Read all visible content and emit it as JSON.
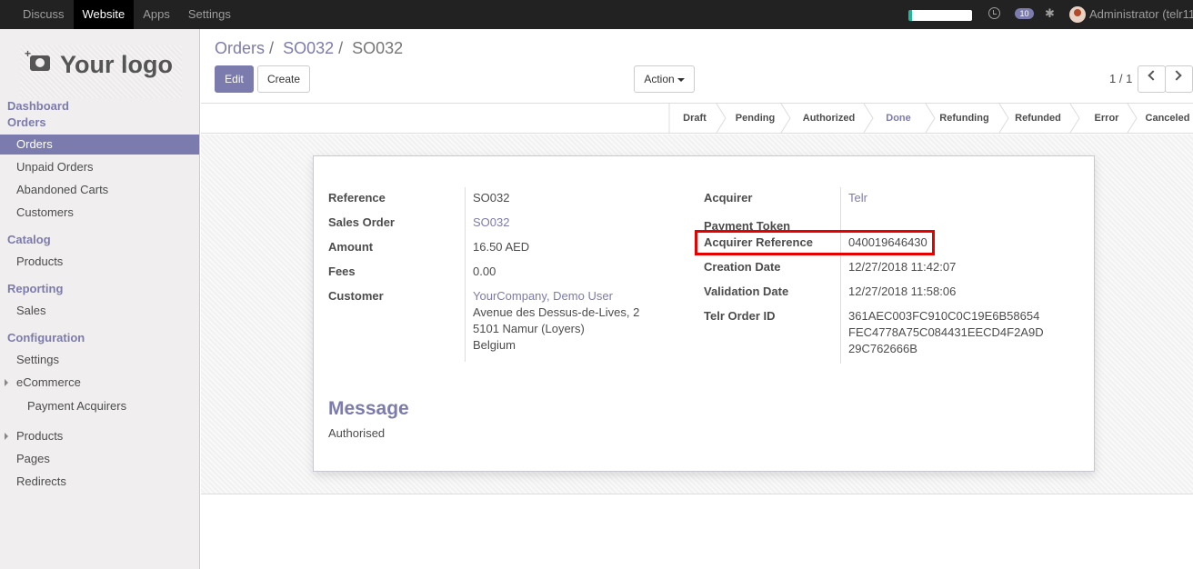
{
  "topbar": {
    "menu": [
      "Discuss",
      "Website",
      "Apps",
      "Settings"
    ],
    "chat_count": "10",
    "user": "Administrator (telr11"
  },
  "sidebar": {
    "logo": "Your logo",
    "dashboard": "Dashboard",
    "orders_section": "Orders",
    "orders_items": [
      "Orders",
      "Unpaid Orders",
      "Abandoned Carts",
      "Customers"
    ],
    "catalog_section": "Catalog",
    "catalog_items": [
      "Products"
    ],
    "reporting_section": "Reporting",
    "reporting_items": [
      "Sales"
    ],
    "configuration_section": "Configuration",
    "configuration_items": [
      "Settings",
      "eCommerce",
      "Payment Acquirers",
      "Products",
      "Pages",
      "Redirects"
    ]
  },
  "breadcrumb": {
    "first": "Orders",
    "second": "SO032",
    "current": "SO032",
    "sep": "/"
  },
  "buttons": {
    "edit": "Edit",
    "create": "Create",
    "action": "Action"
  },
  "pager": "1 / 1",
  "statusbar": {
    "stages": [
      "Draft",
      "Pending",
      "Authorized",
      "Done",
      "Refunding",
      "Refunded",
      "Error",
      "Canceled"
    ],
    "current": "Done"
  },
  "form": {
    "left_labels": [
      "Reference",
      "Sales Order",
      "Amount",
      "Fees",
      "Customer"
    ],
    "reference": "SO032",
    "sales_order": "SO032",
    "amount": "16.50",
    "currency": "AED",
    "fees": "0.00",
    "customer_name": "YourCompany, Demo User",
    "customer_address": [
      "Avenue des Dessus-de-Lives, 2",
      "5101 Namur (Loyers)",
      "Belgium"
    ],
    "right_labels": [
      "Acquirer",
      "Payment Token",
      "Acquirer Reference",
      "Creation Date",
      "Validation Date",
      "Telr Order ID"
    ],
    "acquirer": "Telr",
    "acquirer_reference": "040019646430",
    "creation_date": "12/27/2018 11:42:07",
    "validation_date": "12/27/2018 11:58:06",
    "telr_order_id": [
      "361AEC003FC910C0C19E6B58654",
      "FEC4778A75C084431EECD4F2A9D",
      "29C762666B"
    ],
    "message_title": "Message",
    "message": "Authorised"
  }
}
